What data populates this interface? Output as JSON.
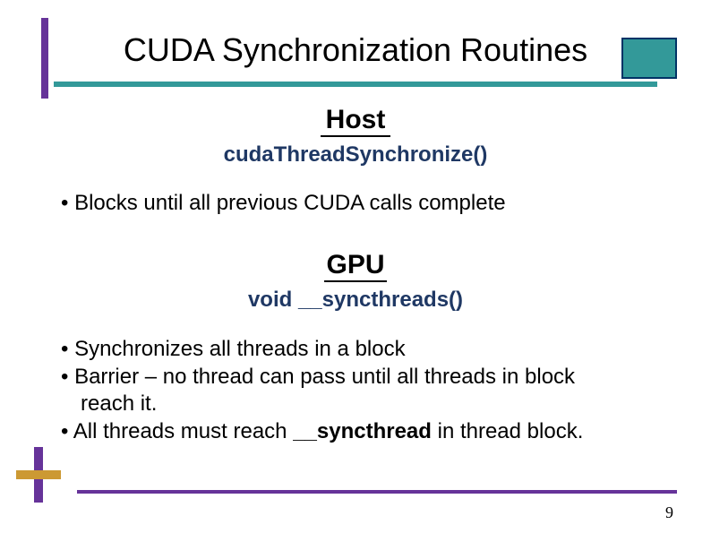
{
  "title": "CUDA Synchronization Routines",
  "section1": {
    "heading": "Host",
    "code": "cudaThreadSynchronize()",
    "bullet": "• Blocks until all previous CUDA calls complete"
  },
  "section2": {
    "heading": "GPU",
    "code": "void __syncthreads()",
    "bullets": [
      "• Synchronizes all threads in a block",
      "• Barrier – no thread can pass until all threads in block",
      "reach it.",
      "• All threads must reach ",
      "__syncthread",
      " in thread block."
    ]
  },
  "pageNumber": "9"
}
